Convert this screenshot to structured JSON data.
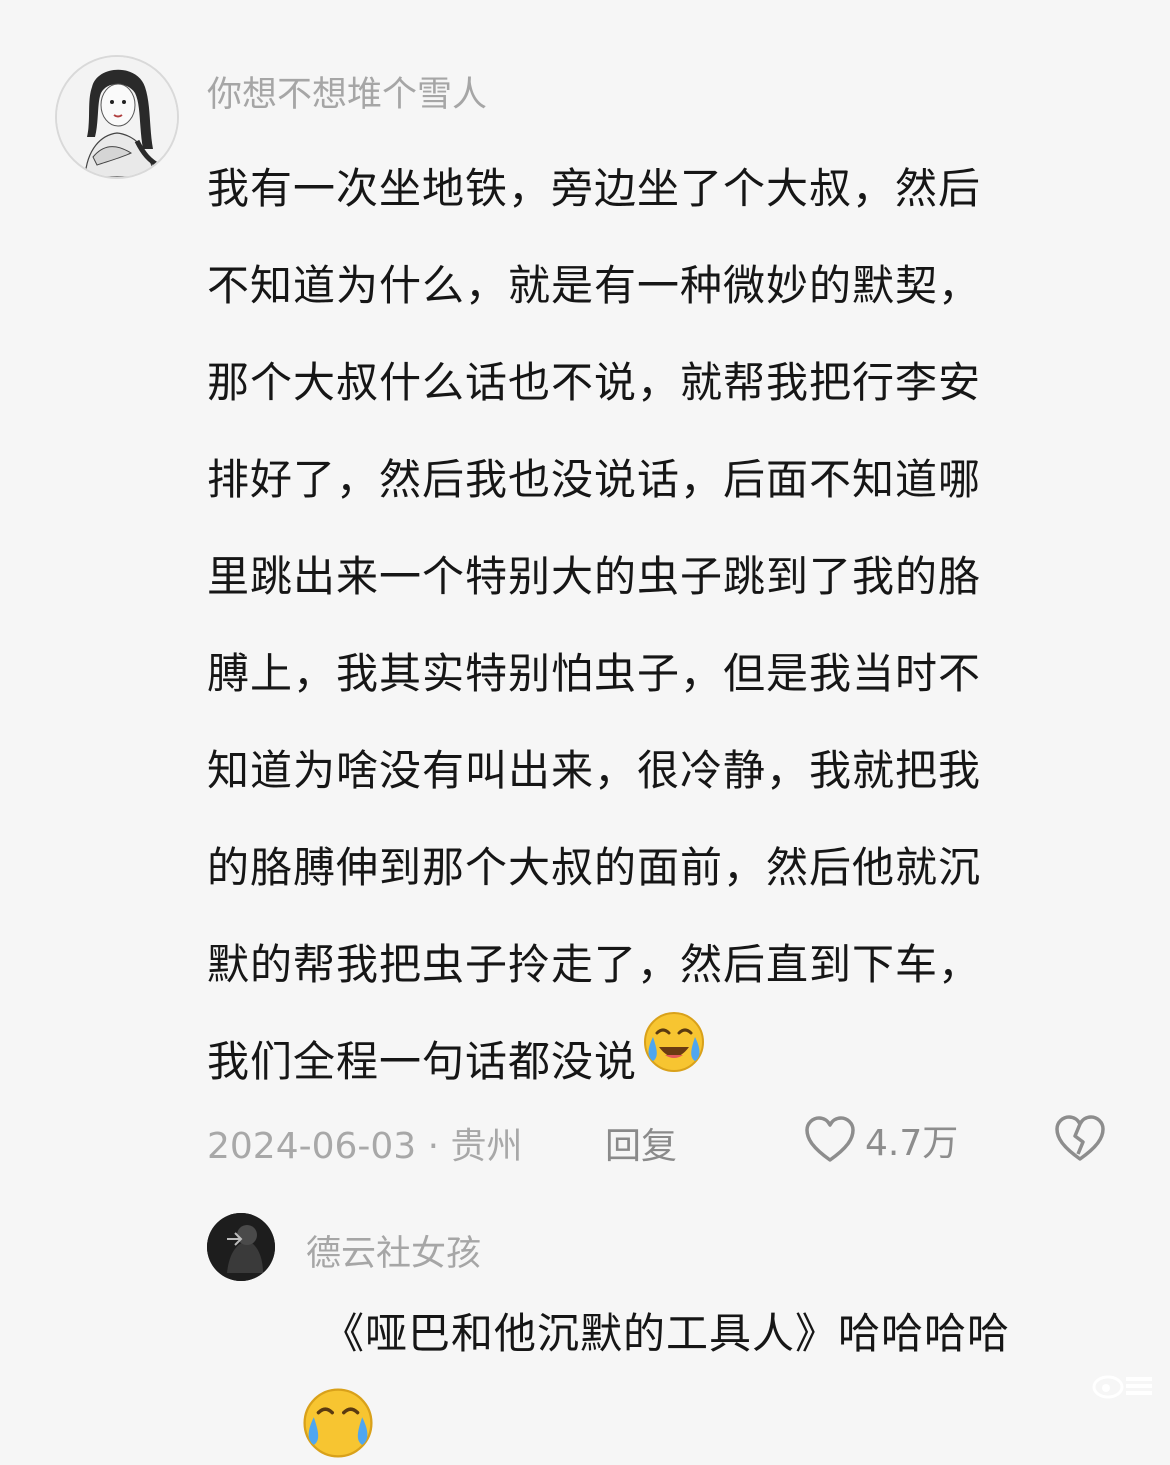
{
  "comment": {
    "username": "你想不想堆个雪人",
    "body_lines": [
      "我有一次坐地铁，旁边坐了个大叔，然后",
      "不知道为什么，就是有一种微妙的默契，",
      "那个大叔什么话也不说，就帮我把行李安",
      "排好了，然后我也没说话，后面不知道哪",
      "里跳出来一个特别大的虫子跳到了我的胳",
      "膊上，我其实特别怕虫子，但是我当时不",
      "知道为啥没有叫出来，很冷静，我就把我",
      "的胳膊伸到那个大叔的面前，然后他就沉",
      "默的帮我把虫子拎走了，然后直到下车，",
      "我们全程一句话都没说"
    ],
    "end_emoji": "laugh-cry-emoji",
    "date_location": "2024-06-03 · 贵州",
    "reply_label": "回复",
    "like_count": "4.7万"
  },
  "reply": {
    "username": "德云社女孩",
    "text": "《哑巴和他沉默的工具人》哈哈哈哈",
    "end_emoji": "laugh-cry-emoji"
  },
  "colors": {
    "background": "#f6f6f6",
    "text": "#161616",
    "muted": "#a6a6a6",
    "emoji_face": "#f7c531"
  }
}
